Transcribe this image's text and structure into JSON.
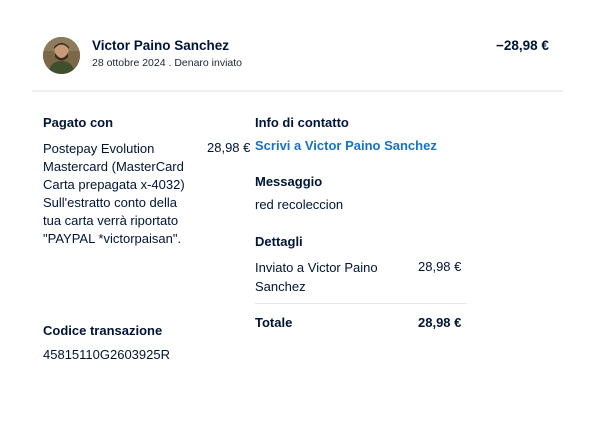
{
  "header": {
    "name": "Victor Paino Sanchez",
    "subtitle": "28 ottobre 2024 . Denaro inviato",
    "amount": "−28,98 €"
  },
  "payment": {
    "heading": "Pagato con",
    "description": "Postepay Evolution Mastercard (MasterCard Carta prepagata x-4032) Sull'estratto conto della tua carta verrà riportato \"PAYPAL *victorpaisan\".",
    "amount": "28,98 €"
  },
  "transaction": {
    "heading": "Codice transazione",
    "code": "45815110G2603925R"
  },
  "contact": {
    "heading": "Info di contatto",
    "link_label": "Scrivi a Victor Paino Sanchez"
  },
  "message": {
    "heading": "Messaggio",
    "text": "red recoleccion"
  },
  "details": {
    "heading": "Dettagli",
    "line_label": "Inviato a Victor Paino Sanchez",
    "line_amount": "28,98 €",
    "total_label": "Totale",
    "total_amount": "28,98 €"
  },
  "colors": {
    "link": "#1672c4",
    "text": "#001435"
  }
}
